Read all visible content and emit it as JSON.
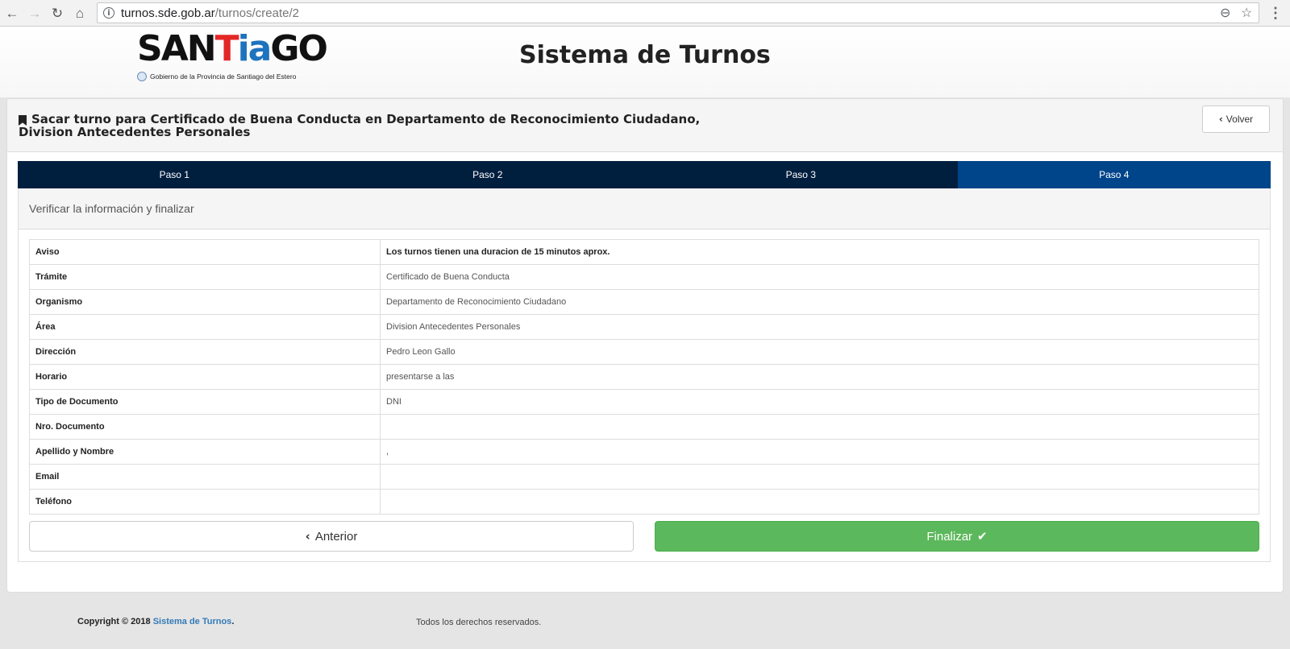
{
  "browser": {
    "url_host": "turnos.sde.gob.ar",
    "url_path": "/turnos/create/2"
  },
  "header": {
    "logo_parts": [
      "SAN",
      "T",
      "ia",
      "GO"
    ],
    "logo_subtitle": "Gobierno de la Provincia de Santiago del Estero",
    "site_title": "Sistema de Turnos"
  },
  "panel": {
    "title": "Sacar turno para Certificado de Buena Conducta en Departamento de Reconocimiento Ciudadano, Division Antecedentes Personales",
    "back_button": "Volver"
  },
  "steps": [
    {
      "label": "Paso 1",
      "active": false
    },
    {
      "label": "Paso 2",
      "active": false
    },
    {
      "label": "Paso 3",
      "active": false
    },
    {
      "label": "Paso 4",
      "active": true
    }
  ],
  "step4": {
    "heading": "Verificar la información y finalizar",
    "rows": [
      {
        "label": "Aviso",
        "value": "Los turnos tienen una duracion de 15 minutos aprox."
      },
      {
        "label": "Trámite",
        "value": "Certificado de Buena Conducta"
      },
      {
        "label": "Organismo",
        "value": "Departamento de Reconocimiento Ciudadano"
      },
      {
        "label": "Área",
        "value": "Division Antecedentes Personales"
      },
      {
        "label": "Dirección",
        "value": "Pedro Leon Gallo"
      },
      {
        "label": "Horario",
        "value": "presentarse a las"
      },
      {
        "label": "Tipo de Documento",
        "value": "DNI"
      },
      {
        "label": "Nro. Documento",
        "value": ""
      },
      {
        "label": "Apellido y Nombre",
        "value": ","
      },
      {
        "label": "Email",
        "value": ""
      },
      {
        "label": "Teléfono",
        "value": ""
      }
    ],
    "prev_button": "Anterior",
    "finish_button": "Finalizar"
  },
  "footer": {
    "copyright_prefix": "Copyright © 2018",
    "copyright_link": "Sistema de Turnos",
    "copyright_suffix": ".",
    "rights": "Todos los derechos reservados."
  },
  "colors": {
    "step_bg": "#001f3f",
    "step_active_bg": "#00448a",
    "finish_green": "#5cb85c",
    "link_blue": "#337ab7"
  }
}
